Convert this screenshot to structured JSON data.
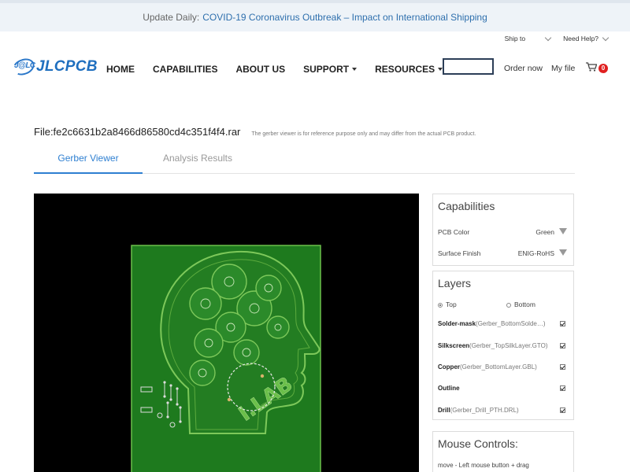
{
  "announcement": {
    "lead": "Update Daily:",
    "link": "COVID-19 Coronavirus Outbreak – Impact on International Shipping"
  },
  "utility": {
    "ship_to": "Ship to",
    "need_help": "Need Help?"
  },
  "brand": {
    "mark": "J@LC",
    "name": "JLCPCB",
    "color": "#1f6fbf"
  },
  "nav": {
    "items": [
      {
        "label": "HOME"
      },
      {
        "label": "CAPABILITIES"
      },
      {
        "label": "ABOUT US"
      },
      {
        "label": "SUPPORT"
      },
      {
        "label": "RESOURCES"
      }
    ],
    "order_now": "Order now",
    "my_file": "My file",
    "cart_count": "0"
  },
  "file": {
    "name": "File:fe2c6631b2a8466d86580cd4c351f4f4.rar",
    "note": "The gerber viewer is for reference purpose only and may differ from the actual PCB product."
  },
  "tabs": [
    {
      "label": "Gerber Viewer",
      "active": true
    },
    {
      "label": "Analysis Results",
      "active": false
    }
  ],
  "capabilities": {
    "title": "Capabilities",
    "rows": [
      {
        "label": "PCB Color",
        "value": "Green"
      },
      {
        "label": "Surface Finish",
        "value": "ENIG-RoHS"
      }
    ]
  },
  "layers": {
    "title": "Layers",
    "side_top": "Top",
    "side_bottom": "Bottom",
    "selected_side": "Top",
    "items": [
      {
        "name": "Solder-mask",
        "file": "(Gerber_BottomSolde…)",
        "checked": true
      },
      {
        "name": "Silkscreen",
        "file": "(Gerber_TopSilkLayer.GTO)",
        "checked": true
      },
      {
        "name": "Copper",
        "file": "(Gerber_BottomLayer.GBL)",
        "checked": true
      },
      {
        "name": "Outline",
        "file": "",
        "checked": true
      },
      {
        "name": "Drill",
        "file": "(Gerber_Drill_PTH.DRL)",
        "checked": true
      }
    ]
  },
  "mouse_controls": {
    "title": "Mouse Controls:",
    "move": "move - Left mouse button + drag"
  },
  "board_label": "I.LAB",
  "colors": {
    "pcb_green": "#1e7a1e",
    "board_outline": "#5fae3f",
    "accent_blue": "#2e7fd1",
    "badge_red": "#e02020"
  }
}
